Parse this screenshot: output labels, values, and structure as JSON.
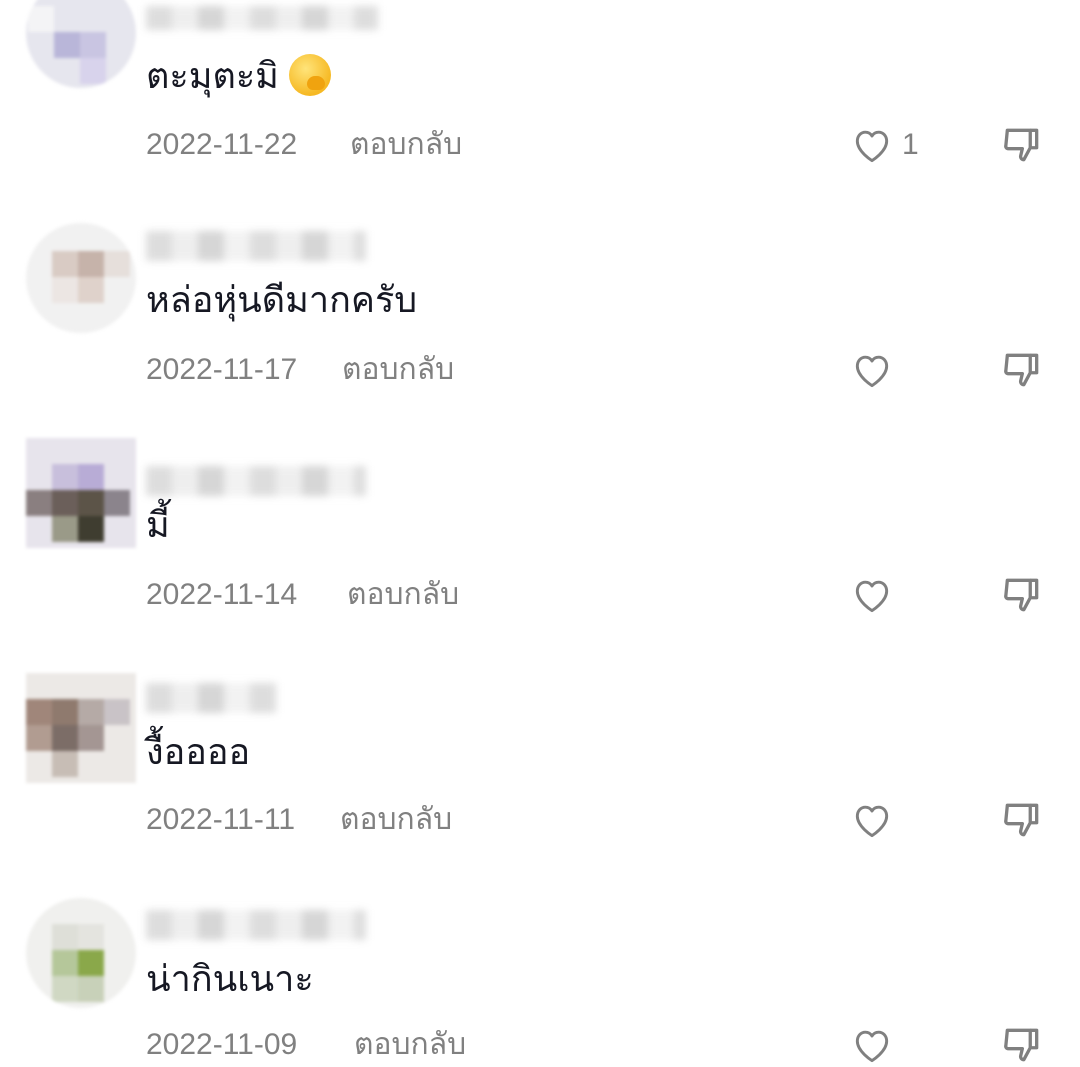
{
  "comments": [
    {
      "username": "",
      "text": "ตะมุตะมิ",
      "emoji": "face-with-hand-over-mouth",
      "date": "2022-11-22",
      "reply_label": "ตอบกลับ",
      "likes": "1"
    },
    {
      "username": "",
      "text": "หล่อหุ่นดีมากครับ",
      "date": "2022-11-17",
      "reply_label": "ตอบกลับ",
      "likes": ""
    },
    {
      "username": "",
      "text": "มี้",
      "date": "2022-11-14",
      "reply_label": "ตอบกลับ",
      "likes": ""
    },
    {
      "username": "",
      "text": "งื้ออออ",
      "date": "2022-11-11",
      "reply_label": "ตอบกลับ",
      "likes": ""
    },
    {
      "username": "",
      "text": "น่ากินเนาะ",
      "date": "2022-11-09",
      "reply_label": "ตอบกลับ",
      "likes": ""
    }
  ],
  "colors": {
    "text_primary": "#161823",
    "text_secondary": "#808080",
    "icon": "#808080"
  },
  "icons": {
    "like": "heart-outline-icon",
    "dislike": "thumbs-down-outline-icon"
  }
}
